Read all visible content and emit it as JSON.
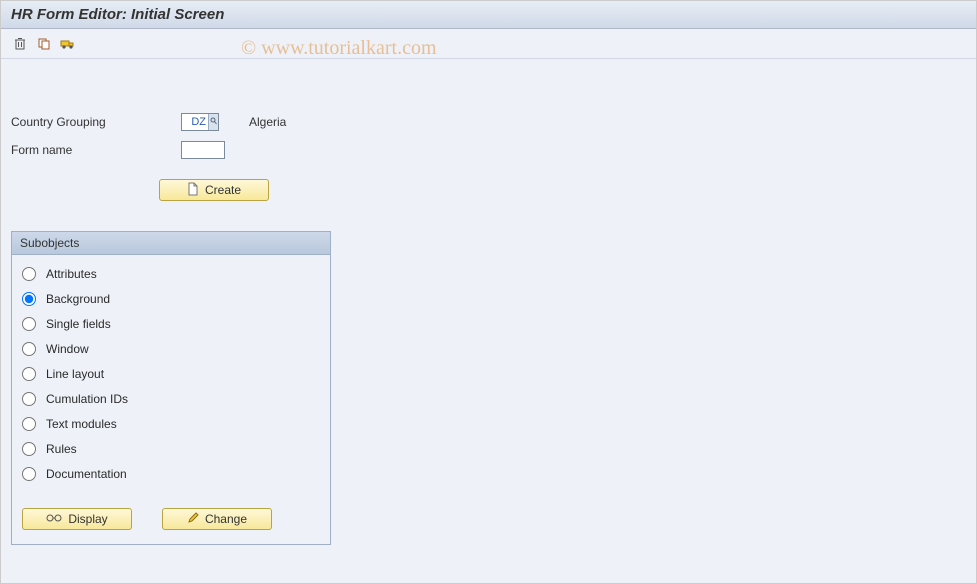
{
  "title": "HR Form Editor: Initial Screen",
  "watermark": "© www.tutorialkart.com",
  "form": {
    "country_grouping_label": "Country Grouping",
    "country_grouping_value": "DZ",
    "country_grouping_desc": "Algeria",
    "form_name_label": "Form name",
    "form_name_value": ""
  },
  "buttons": {
    "create": "Create",
    "display": "Display",
    "change": "Change"
  },
  "subobjects": {
    "title": "Subobjects",
    "items": [
      {
        "label": "Attributes",
        "checked": false
      },
      {
        "label": "Background",
        "checked": true
      },
      {
        "label": "Single fields",
        "checked": false
      },
      {
        "label": "Window",
        "checked": false
      },
      {
        "label": "Line layout",
        "checked": false
      },
      {
        "label": "Cumulation IDs",
        "checked": false
      },
      {
        "label": "Text modules",
        "checked": false
      },
      {
        "label": "Rules",
        "checked": false
      },
      {
        "label": "Documentation",
        "checked": false
      }
    ]
  }
}
